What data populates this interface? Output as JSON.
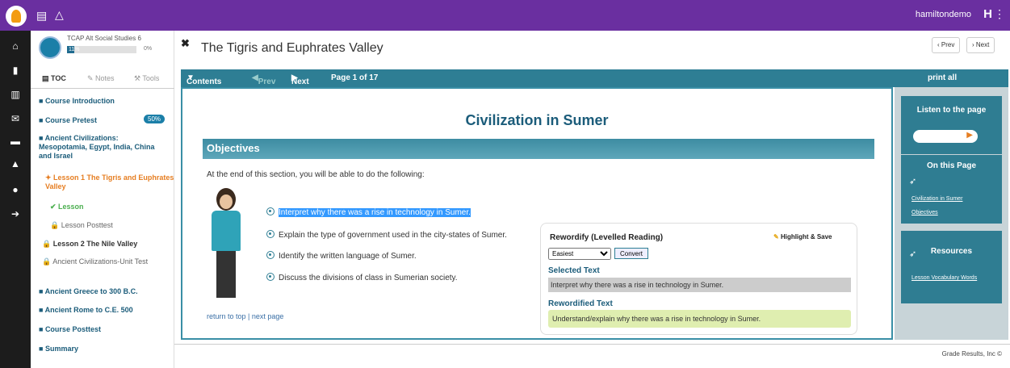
{
  "topbar": {
    "username": "hamiltondemo",
    "initial": "H",
    "icons": [
      "logo-icon",
      "menu-icon",
      "bell-icon",
      "more-icon"
    ]
  },
  "leftnav": {
    "icons": [
      "home-icon",
      "book-icon",
      "chart-icon",
      "mail-icon",
      "chat-icon",
      "bell-icon",
      "circle-icon",
      "logout-icon"
    ]
  },
  "course": {
    "title": "TCAP Alt Social Studies 6",
    "progress_label": "11%",
    "progress_value": 0.11,
    "percent": "0%"
  },
  "panel_tabs": {
    "toc": "TOC",
    "notes": "Notes",
    "tools": "Tools"
  },
  "toc": [
    {
      "label": "Course Introduction"
    },
    {
      "label": "Course Pretest",
      "badge": "50%"
    },
    {
      "label": "Ancient Civilizations: Mesopotamia, Egypt, India, China and Israel"
    },
    {
      "label": "Lesson 1 The Tigris and Euphrates Valley"
    },
    {
      "label": "Lesson"
    },
    {
      "label": "Lesson Posttest"
    },
    {
      "label": "Lesson 2 The Nile Valley"
    },
    {
      "label": "Ancient Civilizations-Unit Test"
    },
    {
      "label": "Ancient Greece to 300 B.C."
    },
    {
      "label": "Ancient Rome to C.E. 500"
    },
    {
      "label": "Course Posttest"
    },
    {
      "label": "Summary"
    }
  ],
  "page": {
    "title": "The Tigris and Euphrates Valley",
    "prev": "Prev",
    "next": "Next"
  },
  "contents_bar": {
    "contents": "Contents",
    "prev": "Prev",
    "next": "Next",
    "page_info": "Page 1 of 17",
    "print_all": "print all"
  },
  "main": {
    "heading": "Civilization in Sumer",
    "objectives_label": "Objectives",
    "intro": "At the end of this section, you will be able to do the following:",
    "objectives": [
      "Interpret why there was a rise in technology in Sumer.",
      "Explain the type of government used in the city-states of Sumer.",
      "Identify the written language of Sumer.",
      "Discuss the divisions of class in Sumerian society."
    ],
    "return_top": "return to top",
    "separator": " | ",
    "next_page": "next page"
  },
  "reword": {
    "title": "Rewordify (Levelled Reading)",
    "highlight_save": "Highlight & Save",
    "level": "Easiest",
    "convert": "Convert",
    "selected_label": "Selected Text",
    "selected_text": "Interpret why there was a rise in technology in Sumer.",
    "reworded_label": "Rewordified Text",
    "reworded_text": "Understand/explain why there was a rise in technology in Sumer."
  },
  "sidebar": {
    "listen_label": "Listen to the page",
    "on_this_page": "On this Page",
    "links": [
      "Civilization in Sumer",
      "Objectives"
    ],
    "resources": "Resources",
    "resource_links": [
      "Lesson Vocabulary Words"
    ]
  },
  "footer": {
    "copyright": "Grade Results, Inc ©"
  }
}
